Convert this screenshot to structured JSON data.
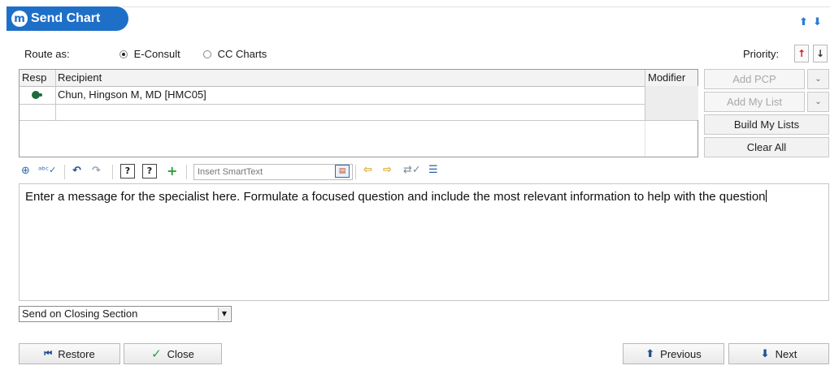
{
  "window": {
    "title": "Send Chart",
    "logo_glyph": "m",
    "brand_color": "#1e6fc8"
  },
  "header": {
    "up_arrow": "⬆",
    "down_arrow": "⬇"
  },
  "route": {
    "label": "Route as:",
    "options": [
      {
        "label": "E-Consult",
        "selected": true
      },
      {
        "label": "CC Charts",
        "selected": false
      }
    ]
  },
  "priority": {
    "label": "Priority:",
    "up_glyph": "↑",
    "down_glyph": "↓",
    "up_color": "#d9141c"
  },
  "recipients": {
    "columns": [
      "Resp",
      "Recipient",
      "Modifier"
    ],
    "rows": [
      {
        "resp_icon": "responsible-dot-icon",
        "recipient": "Chun, Hingson M, MD [HMC05]",
        "modifier": ""
      },
      {
        "resp_icon": "",
        "recipient": "",
        "modifier": ""
      }
    ]
  },
  "side_buttons": {
    "add_pcp": "Add PCP",
    "add_my_list": "Add My List",
    "build_my_lists": "Build My Lists",
    "clear_all": "Clear All"
  },
  "toolbar": {
    "smarttext_placeholder": "Insert SmartText",
    "icons": [
      "zoom-icon",
      "spellcheck-icon",
      "undo-icon",
      "redo-icon",
      "smartphrase-help-icon",
      "smartlink-help-icon",
      "add-smarttext-icon",
      "previous-field-icon",
      "next-field-icon",
      "check-fields-icon",
      "list-icon"
    ]
  },
  "editor": {
    "text": "Enter a message for the specialist here.  Formulate a focused question and include the most relevant information to help with the question"
  },
  "send_select": {
    "value": "Send on Closing Section"
  },
  "footer": {
    "restore": "Restore",
    "close": "Close",
    "previous": "Previous",
    "next": "Next"
  }
}
